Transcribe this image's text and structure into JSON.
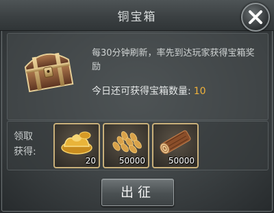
{
  "dialog": {
    "title": "铜宝箱",
    "description": "每30分钟刷新，率先到达玩家获得宝箱奖励",
    "count_label": "今日还可获得宝箱数量:",
    "count_value": "10",
    "accent_color": "#f0b23b"
  },
  "rewards": {
    "label_line1": "领取",
    "label_line2": "获得:",
    "items": [
      {
        "icon": "gold-ingot-icon",
        "qty": "20"
      },
      {
        "icon": "wheat-icon",
        "qty": "50000"
      },
      {
        "icon": "wood-log-icon",
        "qty": "50000"
      }
    ]
  },
  "actions": {
    "march_label": "出征"
  },
  "icons": {
    "close": "close-icon",
    "chest": "treasure-chest-icon"
  }
}
